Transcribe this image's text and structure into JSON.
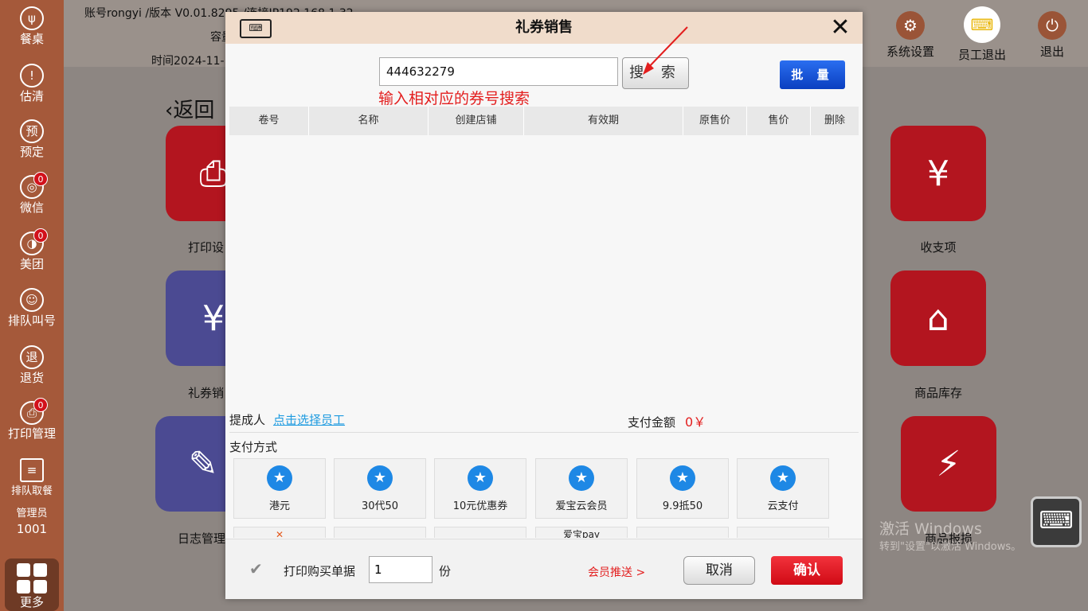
{
  "header": {
    "account_line": "账号rongyi /版本 V0.01.8295 /连接IP192.168.1.32",
    "capacity_line": "容量",
    "time_line": "时间2024-11-",
    "top_buttons": [
      {
        "label": "系统设置",
        "icon": "gear-icon"
      },
      {
        "label": "员工退出",
        "icon": "keyboard-icon"
      },
      {
        "label": "退出",
        "icon": "power-icon"
      }
    ]
  },
  "sidebar": {
    "items": [
      {
        "label": "餐桌",
        "icon": "fork-knife-icon",
        "glyph": "ψ"
      },
      {
        "label": "估清",
        "icon": "warning-icon",
        "glyph": "!"
      },
      {
        "label": "预定",
        "icon": "reserve-icon",
        "glyph": "预"
      },
      {
        "label": "微信",
        "icon": "wechat-icon",
        "glyph": "◎",
        "badge": "0"
      },
      {
        "label": "美团",
        "icon": "meituan-icon",
        "glyph": "◑",
        "badge": "0"
      },
      {
        "label": "排队叫号",
        "icon": "queue-icon",
        "glyph": "☺"
      },
      {
        "label": "退货",
        "icon": "return-icon",
        "glyph": "退"
      },
      {
        "label": "打印管理",
        "icon": "printer-icon",
        "glyph": "⎙",
        "badge": "0"
      },
      {
        "label": "排队取餐",
        "icon": "order-pickup-icon",
        "glyph": "≡"
      }
    ],
    "user_role": "管理员",
    "user_id": "1001",
    "more_label": "更多"
  },
  "background": {
    "back_label": "返回",
    "tiles": [
      {
        "label": "打印设",
        "glyph": "⎙",
        "color": "#b3151f"
      },
      {
        "label": "礼券销",
        "glyph": "¥",
        "color": "#4b4a92"
      },
      {
        "label": "日志管理",
        "glyph": "✎",
        "color": "#4b4a92"
      },
      {
        "label": "收支项",
        "glyph": "¥",
        "color": "#b3151f"
      },
      {
        "label": "商品库存",
        "glyph": "⌂",
        "color": "#b3151f"
      },
      {
        "label": "商品报损",
        "glyph": "⚡",
        "color": "#b3151f"
      }
    ],
    "watermark_title": "激活 Windows",
    "watermark_sub": "转到\"设置\"以激活 Windows。"
  },
  "modal": {
    "title": "礼券销售",
    "search_value": "444632279",
    "search_button": "搜 索",
    "batch_button": "批 量",
    "hint": "输入相对应的券号搜索",
    "columns": [
      "卷号",
      "名称",
      "创建店铺",
      "有效期",
      "原售价",
      "售价",
      "删除"
    ],
    "rows": [],
    "commission_label": "提成人",
    "pick_employee": "点击选择员工",
    "pay_amount_label": "支付金额",
    "pay_amount_value": "0￥",
    "pay_methods_label": "支付方式",
    "pay_methods": [
      "港元",
      "30代50",
      "10元优惠券",
      "爱宝云会员",
      "9.9抵50",
      "云支付"
    ],
    "pay_methods_row2": [
      "",
      "",
      "",
      "爱宝pay",
      "",
      ""
    ],
    "print_receipt_label": "打印购买单据",
    "copies": "1",
    "copies_unit": "份",
    "vip_push": "会员推送 >",
    "cancel": "取消",
    "confirm": "确认"
  }
}
